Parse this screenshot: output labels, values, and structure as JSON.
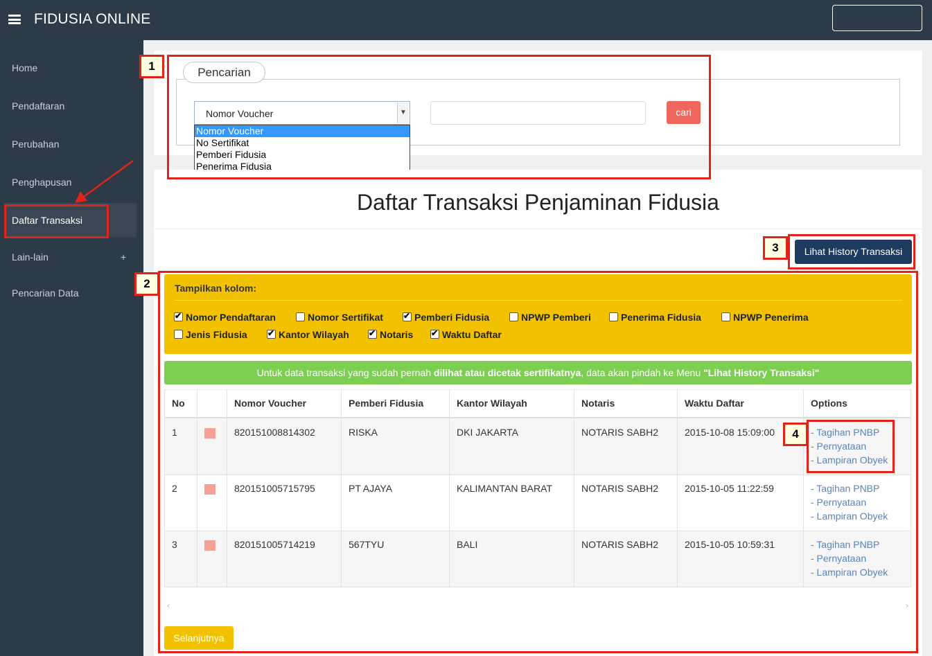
{
  "app": {
    "title": "FIDUSIA ONLINE"
  },
  "sidebar": {
    "items": [
      {
        "label": "Home"
      },
      {
        "label": "Pendaftaran"
      },
      {
        "label": "Perubahan"
      },
      {
        "label": "Penghapusan"
      },
      {
        "label": "Daftar Transaksi",
        "active": true
      },
      {
        "label": "Lain-lain",
        "expand": "+"
      },
      {
        "label": "Pencarian Data"
      }
    ]
  },
  "search": {
    "legend": "Pencarian",
    "select_value": "Nomor Voucher",
    "options": [
      "Nomor Voucher",
      "No Sertifikat",
      "Pemberi Fidusia",
      "Penerima Fidusia"
    ],
    "input_value": "",
    "button": "cari"
  },
  "main": {
    "title": "Daftar Transaksi Penjaminan Fidusia",
    "history_button": "Lihat History Transaksi",
    "columns_title": "Tampilkan kolom:",
    "columns": [
      {
        "label": "Nomor Pendaftaran",
        "checked": true
      },
      {
        "label": "Nomor Sertifikat",
        "checked": false
      },
      {
        "label": "Pemberi Fidusia",
        "checked": true
      },
      {
        "label": "NPWP Pemberi",
        "checked": false
      },
      {
        "label": "Penerima Fidusia",
        "checked": false
      },
      {
        "label": "NPWP Penerima",
        "checked": false
      },
      {
        "label": "Jenis Fidusia",
        "checked": false
      },
      {
        "label": "Kantor Wilayah",
        "checked": true
      },
      {
        "label": "Notaris",
        "checked": true
      },
      {
        "label": "Waktu Daftar",
        "checked": true
      }
    ],
    "info": {
      "before": "Untuk data transaksi yang sudah pernah ",
      "bold": "dilihat atau dicetak sertifikatnya",
      "middle": ", data akan pindah ke Menu ",
      "bold2": "\"Lihat History Transaksi\""
    },
    "table": {
      "headers": [
        "No",
        "",
        "Nomor Voucher",
        "Pemberi Fidusia",
        "Kantor Wilayah",
        "Notaris",
        "Waktu Daftar",
        "Options"
      ],
      "rows": [
        {
          "no": "1",
          "voucher": "820151008814302",
          "pemberi": "RISKA",
          "kantor": "DKI JAKARTA",
          "notaris": "NOTARIS SABH2",
          "waktu": "2015-10-08 15:09:00"
        },
        {
          "no": "2",
          "voucher": "820151005715795",
          "pemberi": "PT AJAYA",
          "kantor": "KALIMANTAN BARAT",
          "notaris": "NOTARIS SABH2",
          "waktu": "2015-10-05 11:22:59"
        },
        {
          "no": "3",
          "voucher": "820151005714219",
          "pemberi": "567TYU",
          "kantor": "BALI",
          "notaris": "NOTARIS SABH2",
          "waktu": "2015-10-05 10:59:31"
        }
      ],
      "options": [
        "- Tagihan PNBP",
        "- Pernyataan",
        "- Lampiran Obyek"
      ]
    },
    "scroll_left": "‹",
    "scroll_right": "›",
    "next_button": "Selanjutnya"
  },
  "annotations": [
    "1",
    "2",
    "3",
    "4"
  ],
  "colors": {
    "sidebar": "#2d3a47",
    "accent_red": "#f0665c",
    "yellow": "#f2c200",
    "green": "#7ccf50",
    "navy": "#1d3a5f",
    "annotation": "#e2231a"
  }
}
